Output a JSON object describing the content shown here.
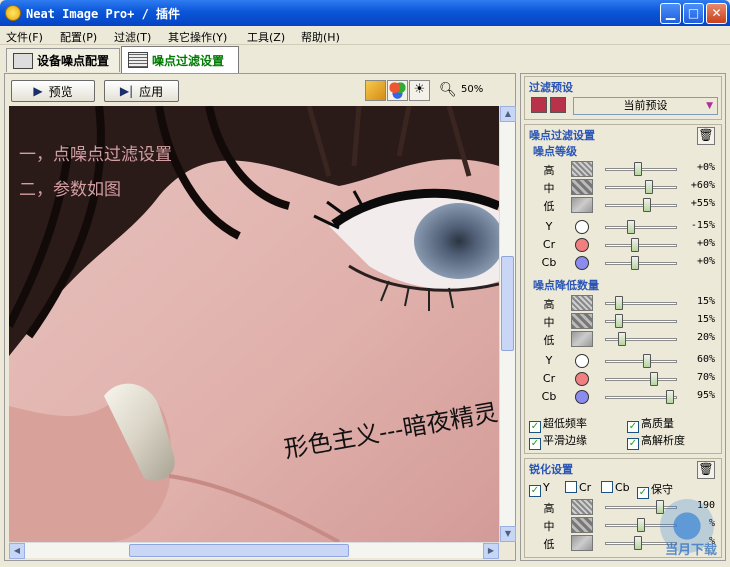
{
  "window": {
    "title": "Neat Image Pro+ / 插件"
  },
  "menu": [
    "文件(F)",
    "配置(P)",
    "过滤(T)",
    "其它操作(Y)",
    "工具(Z)",
    "帮助(H)"
  ],
  "tabs": [
    {
      "label": "设备噪点配置"
    },
    {
      "label": "噪点过滤设置"
    }
  ],
  "toolbar": {
    "preview": "预览",
    "apply": "应用",
    "zoom": "50%"
  },
  "photo_text": {
    "step1": "一，点噪点过滤设置",
    "step2": "二，参数如图",
    "signature": "形色主义---暗夜精灵"
  },
  "filter_preset": {
    "title": "过滤预设",
    "current": "当前预设"
  },
  "filter_settings": {
    "title": "噪点过滤设置",
    "noise_levels": {
      "title": "噪点等级",
      "rows": [
        {
          "label": "高",
          "value": "+0%",
          "level": 0.45
        },
        {
          "label": "中",
          "value": "+60%",
          "level": 0.62
        },
        {
          "label": "低",
          "value": "+55%",
          "level": 0.6
        },
        {
          "label": "Y",
          "value": "-15%",
          "level": 0.35
        },
        {
          "label": "Cr",
          "value": "+0%",
          "level": 0.4
        },
        {
          "label": "Cb",
          "value": "+0%",
          "level": 0.4
        }
      ]
    },
    "noise_reduction": {
      "title": "噪点降低数量",
      "rows": [
        {
          "label": "高",
          "value": "15%",
          "level": 0.15
        },
        {
          "label": "中",
          "value": "15%",
          "level": 0.15
        },
        {
          "label": "低",
          "value": "20%",
          "level": 0.2
        },
        {
          "label": "Y",
          "value": "60%",
          "level": 0.6
        },
        {
          "label": "Cr",
          "value": "70%",
          "level": 0.7
        },
        {
          "label": "Cb",
          "value": "95%",
          "level": 0.95
        }
      ]
    },
    "options": [
      {
        "label": "超低频率",
        "checked": true
      },
      {
        "label": "高质量",
        "checked": true
      },
      {
        "label": "平滑边缘",
        "checked": true
      },
      {
        "label": "高解析度",
        "checked": true
      }
    ]
  },
  "sharpening": {
    "title": "锐化设置",
    "channels": [
      {
        "label": "Y",
        "checked": true
      },
      {
        "label": "Cr",
        "checked": false
      },
      {
        "label": "Cb",
        "checked": false
      },
      {
        "label": "保守",
        "checked": true
      }
    ],
    "rows": [
      {
        "label": "高",
        "value": "190",
        "level": 0.8
      },
      {
        "label": "中",
        "value": "%",
        "level": 0.5
      },
      {
        "label": "低",
        "value": "%",
        "level": 0.45
      }
    ]
  },
  "watermark": {
    "text": "当月下载"
  },
  "colors": {
    "title_bar": "#0a56d8",
    "accent_label": "#2a55b5",
    "tab_active_text": "#007a00",
    "cr": "#f08080",
    "cb": "#8c8cf0"
  }
}
